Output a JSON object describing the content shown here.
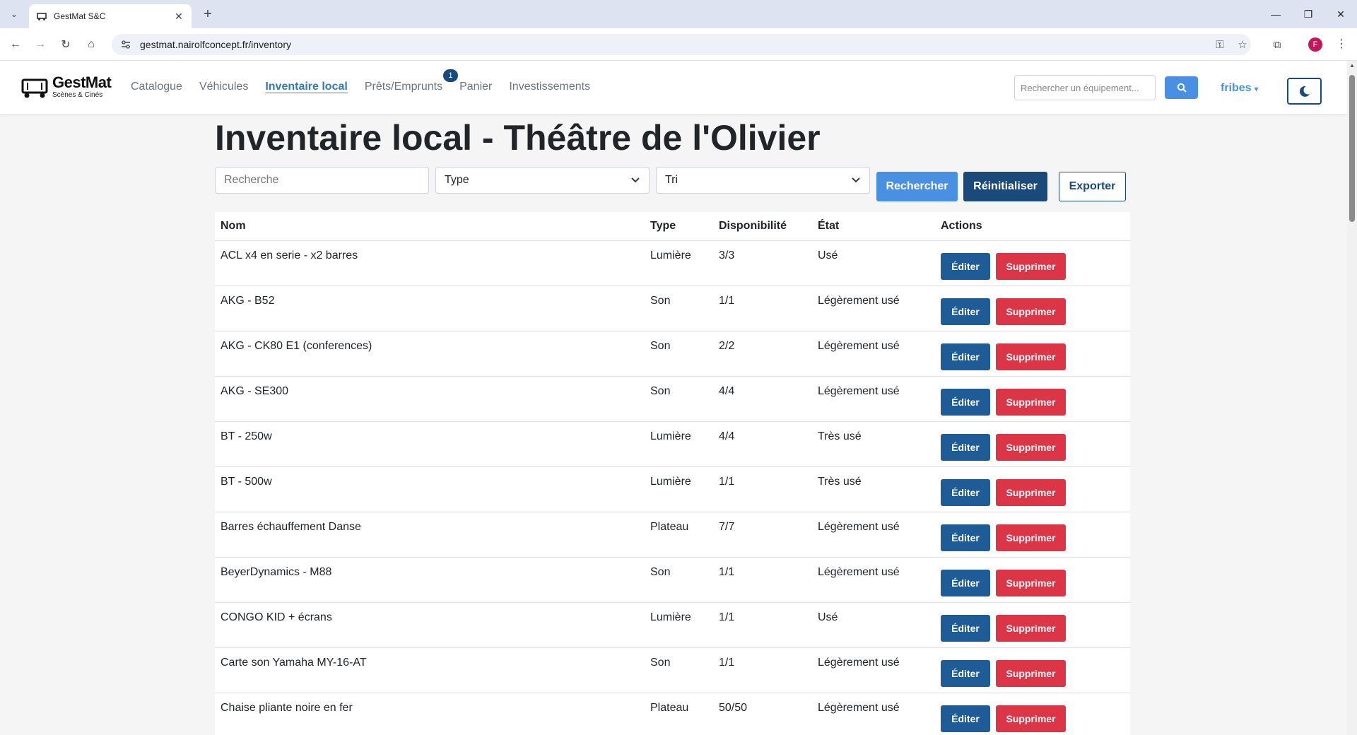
{
  "browser": {
    "tab_title": "GestMat S&C",
    "url": "gestmat.nairolfconcept.fr/inventory",
    "avatar_letter": "F"
  },
  "nav": {
    "logo_name": "GestMat",
    "logo_sub": "Scènes & Cinés",
    "links": [
      "Catalogue",
      "Véhicules",
      "Inventaire local",
      "Prêts/Emprunts",
      "Panier",
      "Investissements"
    ],
    "active_link": "Inventaire local",
    "loans_badge": "1",
    "search_placeholder": "Rechercher un équipement...",
    "user": "fribes"
  },
  "page": {
    "title": "Inventaire local - Théâtre de l'Olivier",
    "search_placeholder": "Recherche",
    "type_select": "Type",
    "sort_select": "Tri",
    "btn_search": "Rechercher",
    "btn_reset": "Réinitialiser",
    "btn_export": "Exporter"
  },
  "table": {
    "headers": [
      "Nom",
      "Type",
      "Disponibilité",
      "État",
      "Actions"
    ],
    "edit_label": "Éditer",
    "delete_label": "Supprimer",
    "rows": [
      {
        "nom": "ACL x4 en serie - x2 barres",
        "type": "Lumière",
        "dispo": "3/3",
        "etat": "Usé"
      },
      {
        "nom": "AKG - B52",
        "type": "Son",
        "dispo": "1/1",
        "etat": "Légèrement usé"
      },
      {
        "nom": "AKG - CK80 E1 (conferences)",
        "type": "Son",
        "dispo": "2/2",
        "etat": "Légèrement usé"
      },
      {
        "nom": "AKG - SE300",
        "type": "Son",
        "dispo": "4/4",
        "etat": "Légèrement usé"
      },
      {
        "nom": "BT - 250w",
        "type": "Lumière",
        "dispo": "4/4",
        "etat": "Très usé"
      },
      {
        "nom": "BT - 500w",
        "type": "Lumière",
        "dispo": "1/1",
        "etat": "Très usé"
      },
      {
        "nom": "Barres échauffement Danse",
        "type": "Plateau",
        "dispo": "7/7",
        "etat": "Légèrement usé"
      },
      {
        "nom": "BeyerDynamics - M88",
        "type": "Son",
        "dispo": "1/1",
        "etat": "Légèrement usé"
      },
      {
        "nom": "CONGO KID + écrans",
        "type": "Lumière",
        "dispo": "1/1",
        "etat": "Usé"
      },
      {
        "nom": "Carte son Yamaha MY-16-AT",
        "type": "Son",
        "dispo": "1/1",
        "etat": "Légèrement usé"
      },
      {
        "nom": "Chaise pliante noire en fer",
        "type": "Plateau",
        "dispo": "50/50",
        "etat": "Légèrement usé"
      }
    ]
  }
}
